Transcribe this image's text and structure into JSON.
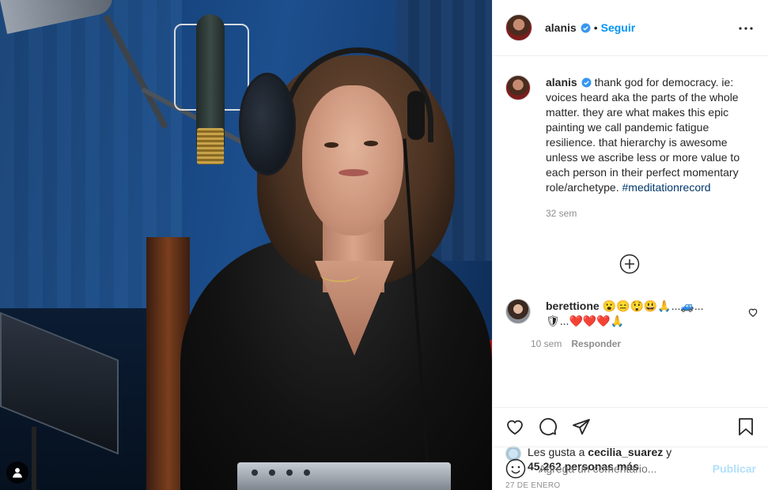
{
  "header": {
    "username": "alanis",
    "separator": "•",
    "follow_label": "Seguir",
    "more_icon": "more-horizontal-icon"
  },
  "caption": {
    "username": "alanis",
    "text": "thank god for democracy. ie: voices heard aka the parts of the whole matter. they are what makes this epic painting we call pandemic fatigue resilience. that hierarchy is awesome unless we ascribe less or more value to each person in their perfect momentary role/archetype.",
    "hashtag": "#meditationrecord",
    "time": "32 sem"
  },
  "comments": [
    {
      "username": "berettione",
      "text": "😮😑😲😃🙏...🚙...🛡...❤️❤️❤️🙏",
      "time": "10 sem",
      "reply_label": "Responder"
    }
  ],
  "likes": {
    "prefix": "Les gusta a",
    "user": "cecilia_suarez",
    "connector": "y",
    "count_text": "45,262 personas más"
  },
  "date": "27 DE ENERO",
  "add_comment": {
    "placeholder": "Agrega un comentario...",
    "publish_label": "Publicar"
  },
  "colors": {
    "accent": "#0095f6",
    "hashtag": "#00376b",
    "muted": "#8e8e8e",
    "publish_disabled": "#b2dffc"
  }
}
